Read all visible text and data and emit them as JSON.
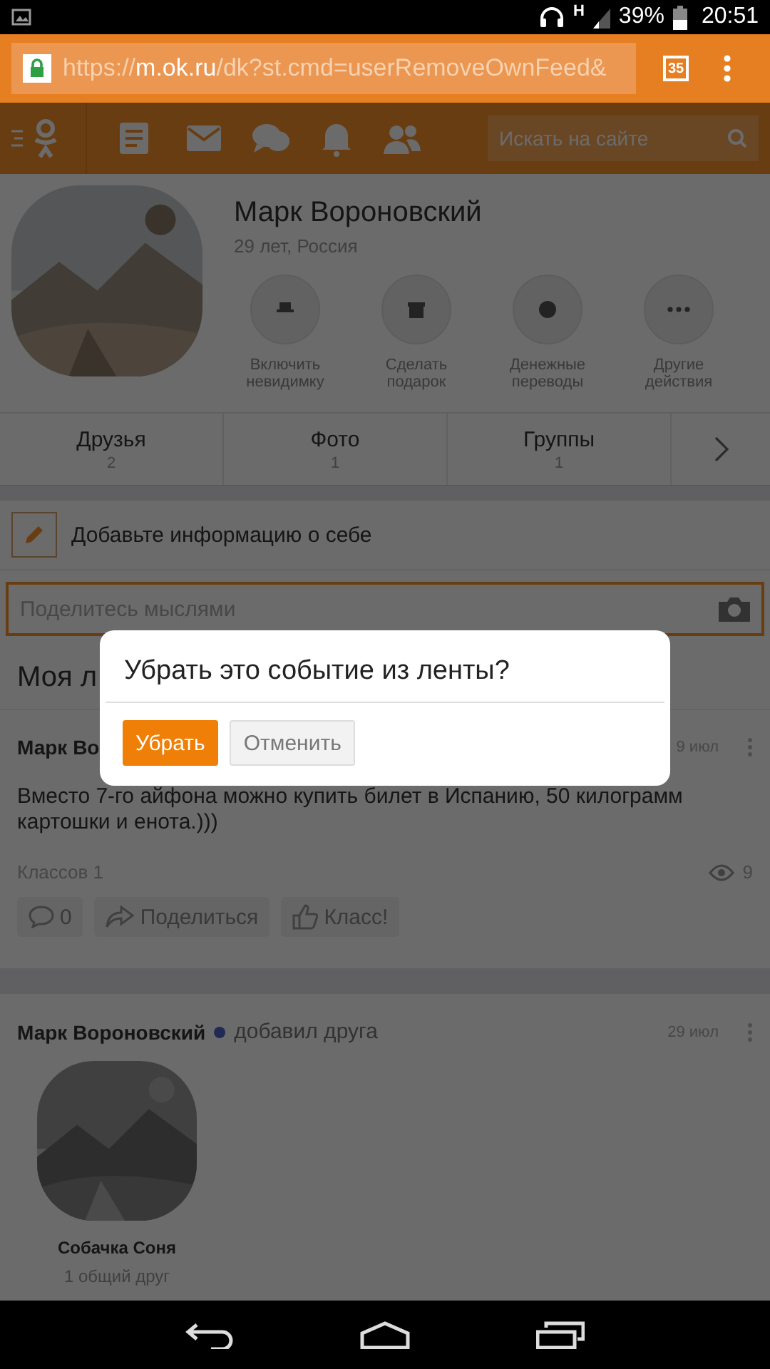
{
  "status_bar": {
    "network": "H",
    "battery": "39%",
    "time": "20:51"
  },
  "browser": {
    "url_scheme": "https://",
    "url_host": "m.ok.ru",
    "url_path": "/dk?st.cmd=userRemoveOwnFeed&",
    "tab_count": "35"
  },
  "nav": {
    "search": {
      "placeholder": "Искать на сайте"
    }
  },
  "profile": {
    "name": "Марк Вороновский",
    "info": "29 лет, Россия",
    "actions": [
      {
        "label": "Включить невидимку",
        "kind": "hat"
      },
      {
        "label": "Сделать подарок",
        "kind": "gift"
      },
      {
        "label": "Денежные переводы",
        "kind": "money"
      },
      {
        "label": "Другие действия",
        "kind": "more"
      }
    ]
  },
  "sections": [
    {
      "label": "Друзья",
      "count": "2"
    },
    {
      "label": "Фото",
      "count": "1"
    },
    {
      "label": "Группы",
      "count": "1"
    }
  ],
  "add_info": "Добавьте информацию о себе",
  "composer": {
    "placeholder": "Поделитесь мыслями"
  },
  "feed_title": "Моя л",
  "post": {
    "author": "Марк Во",
    "date": "9 июл",
    "text": "Вместо 7-го айфона можно купить билет в Испанию, 50 килограмм картошки и енота.)))",
    "likes": "Классов 1",
    "views": "9",
    "comments": "0",
    "share": "Поделиться",
    "like": "Класс!"
  },
  "friend_post": {
    "author": "Марк Вороновский",
    "online": true,
    "action": "добавил друга",
    "date": "29 июл",
    "friend_name": "Собачка Соня",
    "mutual": "1 общий друг"
  },
  "dialog": {
    "title": "Убрать это событие из ленты?",
    "buttons": [
      {
        "label": "Убрать",
        "kind": "primary"
      },
      {
        "label": "Отменить",
        "kind": "secondary"
      }
    ]
  }
}
